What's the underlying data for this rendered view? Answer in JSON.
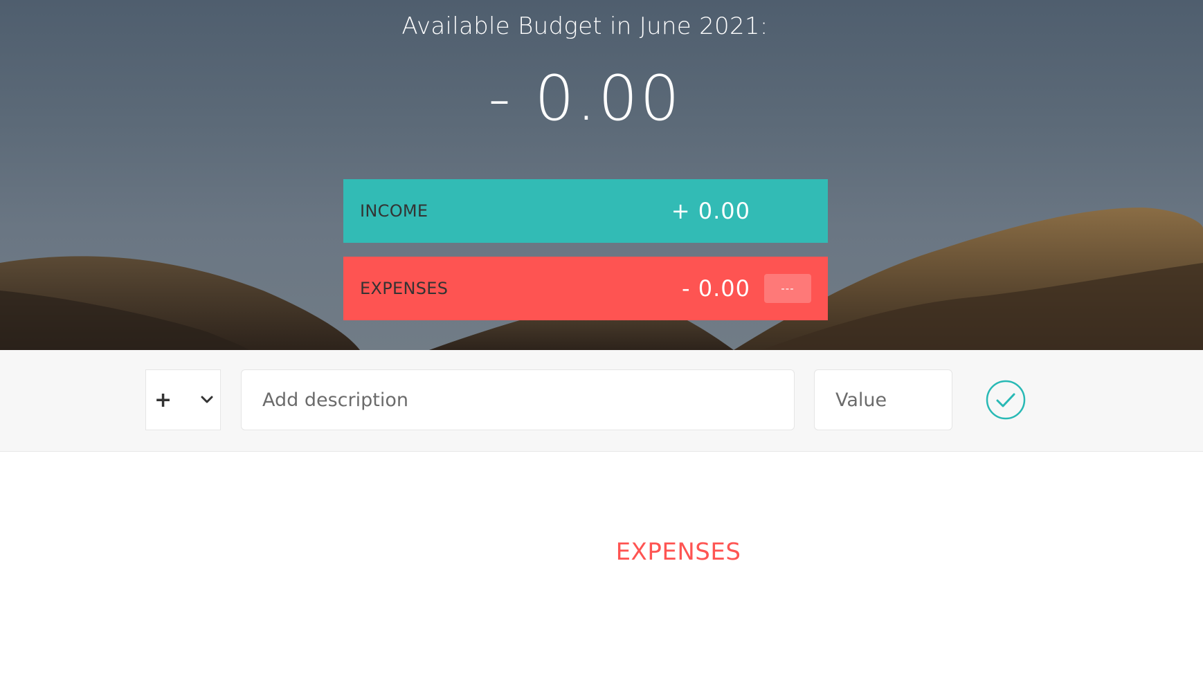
{
  "header": {
    "title": "Available Budget in June 2021:",
    "budget_value": "- 0.00"
  },
  "summary": {
    "income": {
      "label": "INCOME",
      "value": "+ 0.00"
    },
    "expenses": {
      "label": "EXPENSES",
      "value": "- 0.00",
      "percentage": "---"
    }
  },
  "add_form": {
    "type_selected": "+",
    "type_icon": "chevron-down-icon",
    "description_placeholder": "Add description",
    "value_placeholder": "Value",
    "submit_icon": "checkmark-circle-icon"
  },
  "lists": {
    "expenses_title": "EXPENSES"
  },
  "colors": {
    "income": "#32bbb5",
    "expenses": "#fe5452",
    "accent": "#28b9b5"
  }
}
